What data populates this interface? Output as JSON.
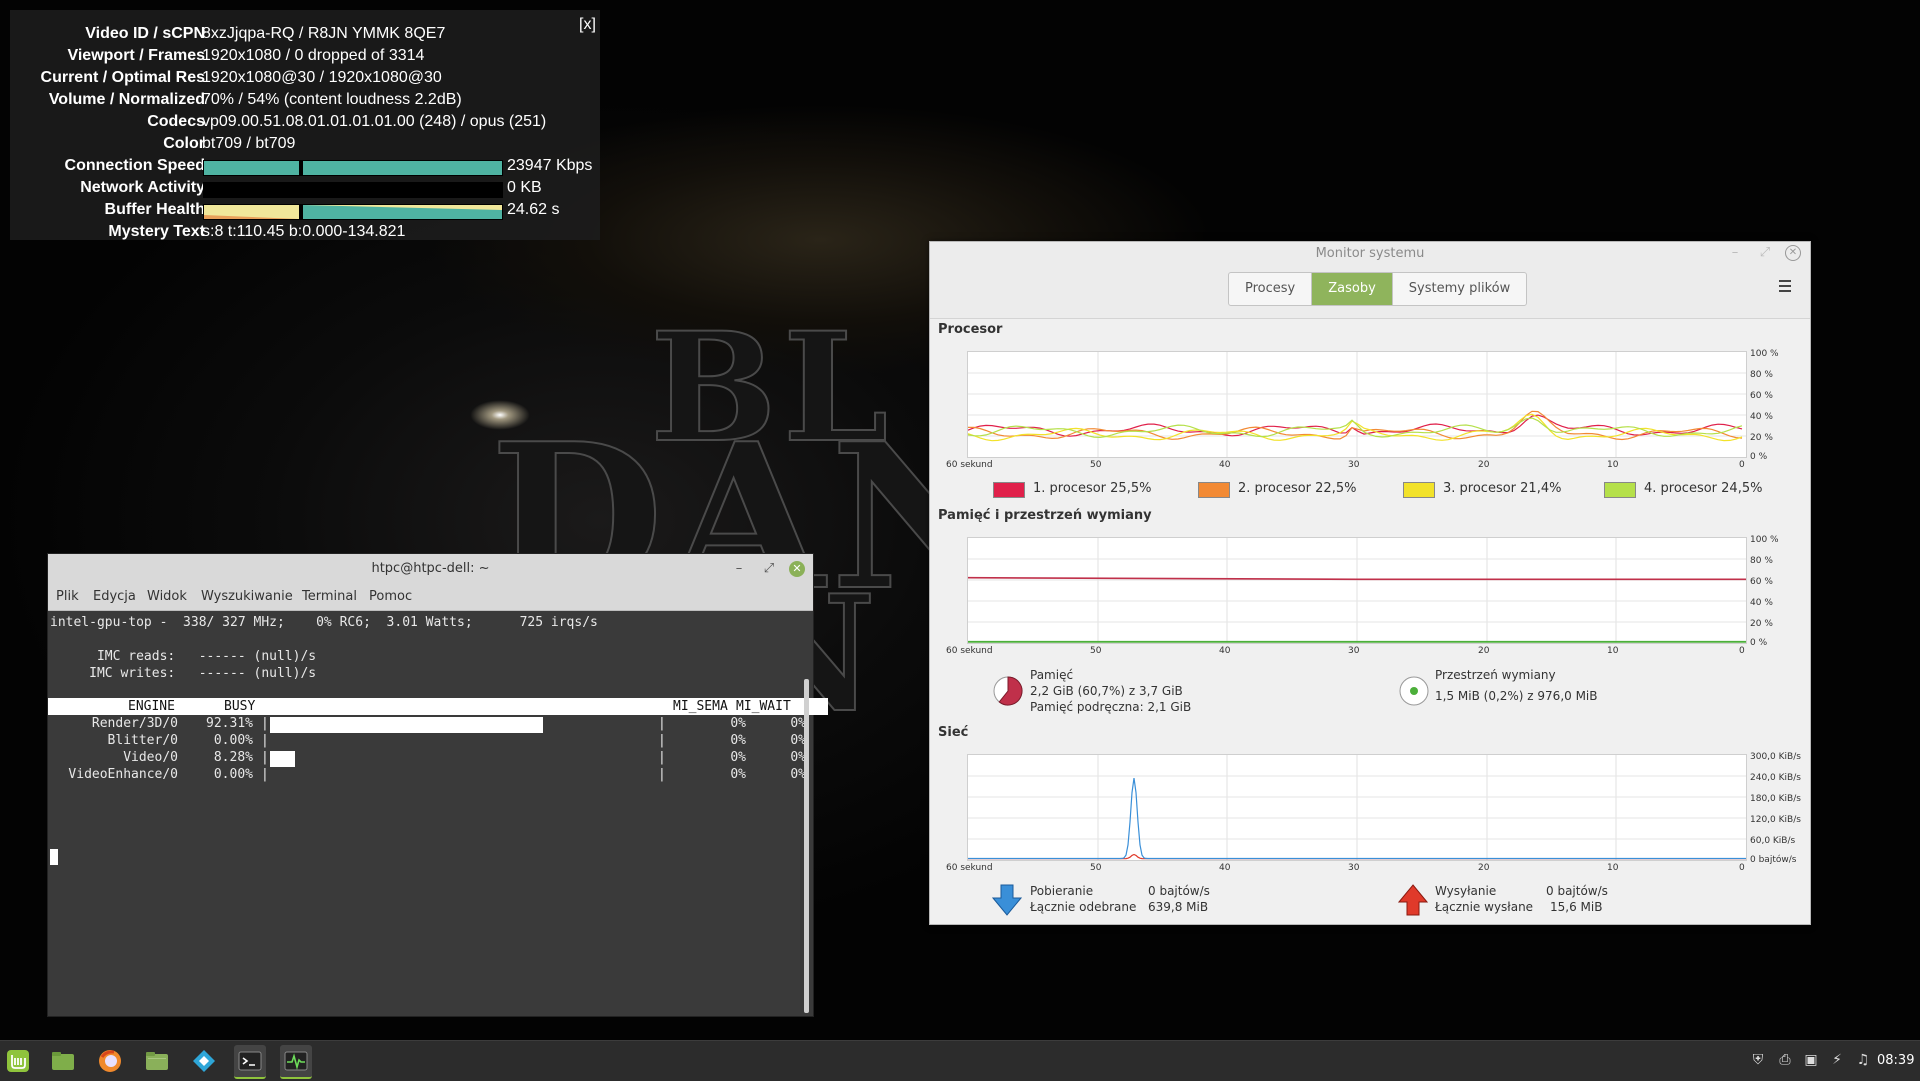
{
  "video": {
    "title_art": [
      "BL",
      "DAN",
      "N"
    ]
  },
  "stats_overlay": {
    "close_label": "[x]",
    "rows": [
      {
        "label": "Video ID / sCPN",
        "value": "8xzJjqpa-RQ / R8JN YMMK 8QE7"
      },
      {
        "label": "Viewport / Frames",
        "value": "1920x1080 / 0 dropped of 3314"
      },
      {
        "label": "Current / Optimal Res",
        "value": "1920x1080@30 / 1920x1080@30"
      },
      {
        "label": "Volume / Normalized",
        "value": "70% / 54% (content loudness 2.2dB)"
      },
      {
        "label": "Codecs",
        "value": "vp09.00.51.08.01.01.01.01.00 (248) / opus (251)"
      },
      {
        "label": "Color",
        "value": "bt709 / bt709"
      }
    ],
    "connection_speed": {
      "label": "Connection Speed",
      "value": "23947 Kbps",
      "level": 1.0
    },
    "network_activity": {
      "label": "Network Activity",
      "value": "0 KB",
      "level": 0.0
    },
    "buffer_health": {
      "label": "Buffer Health",
      "value": "24.62 s",
      "level": 1.0
    },
    "mystery_text": {
      "label": "Mystery Text",
      "value": "s:8 t:110.45 b:0.000-134.821"
    },
    "colors": {
      "bar_teal": "#4fb3a2",
      "bar_yellow": "#f0e79a",
      "bar_orange": "#e8a05a"
    }
  },
  "terminal": {
    "title": "htpc@htpc-dell: ~",
    "window_controls": {
      "minimize": "–",
      "maximize": "⤢",
      "close": "✕"
    },
    "menu": [
      "Plik",
      "Edycja",
      "Widok",
      "Wyszukiwanie",
      "Terminal",
      "Pomoc"
    ],
    "lines": [
      "intel-gpu-top -  338/ 327 MHz;    0% RC6;  3.01 Watts;      725 irqs/s",
      "",
      "      IMC reads:   ------ (null)/s",
      "     IMC writes:   ------ (null)/s"
    ],
    "table_header": {
      "engine": "ENGINE",
      "busy": "BUSY",
      "mi_sema": "MI_SEMA",
      "mi_wait": "MI_WAIT"
    },
    "engines": [
      {
        "name": "Render/3D/0",
        "busy": "92.31%",
        "busy_level": 0.9231,
        "mi_sema": "0%",
        "mi_wait": "0%"
      },
      {
        "name": "Blitter/0",
        "busy": "0.00%",
        "busy_level": 0.0,
        "mi_sema": "0%",
        "mi_wait": "0%"
      },
      {
        "name": "Video/0",
        "busy": "8.28%",
        "busy_level": 0.0828,
        "mi_sema": "0%",
        "mi_wait": "0%"
      },
      {
        "name": "VideoEnhance/0",
        "busy": "0.00%",
        "busy_level": 0.0,
        "mi_sema": "0%",
        "mi_wait": "0%"
      }
    ]
  },
  "sysmon": {
    "title": "Monitor systemu",
    "tabs": [
      {
        "label": "Procesy",
        "active": false
      },
      {
        "label": "Zasoby",
        "active": true
      },
      {
        "label": "Systemy plików",
        "active": false
      }
    ],
    "cpu": {
      "section_title": "Procesor",
      "x_labels": [
        "60 sekund",
        "50",
        "40",
        "30",
        "20",
        "10",
        "0"
      ],
      "y_labels": [
        "100 %",
        "80 %",
        "60 %",
        "40 %",
        "20 %",
        "0 %"
      ],
      "legend": [
        {
          "label": "1. procesor  25,5%",
          "color": "#e0204a"
        },
        {
          "label": "2. procesor  22,5%",
          "color": "#f28a34"
        },
        {
          "label": "3. procesor  21,4%",
          "color": "#f2e22a"
        },
        {
          "label": "4. procesor  24,5%",
          "color": "#b5e04a"
        }
      ]
    },
    "memory": {
      "section_title": "Pamięć i przestrzeń wymiany",
      "x_labels": [
        "60 sekund",
        "50",
        "40",
        "30",
        "20",
        "10",
        "0"
      ],
      "y_labels": [
        "100 %",
        "80 %",
        "60 %",
        "40 %",
        "20 %",
        "0 %"
      ],
      "mem_label": "Pamięć",
      "mem_value": "2,2 GiB (60,7%) z 3,7 GiB",
      "mem_cache": "Pamięć podręczna: 2,1 GiB",
      "mem_level": 0.607,
      "swap_label": "Przestrzeń wymiany",
      "swap_value": "1,5 MiB (0,2%) z 976,0 MiB",
      "swap_level": 0.002,
      "colors": {
        "memory": "#c0304a",
        "swap": "#4caf3a"
      }
    },
    "network": {
      "section_title": "Sieć",
      "x_labels": [
        "60 sekund",
        "50",
        "40",
        "30",
        "20",
        "10",
        "0"
      ],
      "y_labels": [
        "300,0 KiB/s",
        "240,0 KiB/s",
        "180,0 KiB/s",
        "120,0 KiB/s",
        "60,0 KiB/s",
        "0 bajtów/s"
      ],
      "download_label": "Pobieranie",
      "download_rate": "0 bajtów/s",
      "received_label": "Łącznie odebrane",
      "received_total": "639,8 MiB",
      "upload_label": "Wysyłanie",
      "upload_rate": "0 bajtów/s",
      "sent_label": "Łącznie wysłane",
      "sent_total": "15,6 MiB",
      "colors": {
        "download": "#3a8fd8",
        "upload": "#e03a2a"
      }
    }
  },
  "taskbar": {
    "apps": [
      {
        "name": "menu-icon-mint",
        "color": "#8fc43c"
      },
      {
        "name": "files-icon",
        "color": "#7fae4a"
      },
      {
        "name": "firefox-icon",
        "color": "#f0892c"
      },
      {
        "name": "folder-icon",
        "color": "#8ab05a"
      },
      {
        "name": "kodi-icon",
        "color": "#2ea6d8"
      },
      {
        "name": "terminal-icon",
        "color": "#333333"
      },
      {
        "name": "system-monitor-icon",
        "color": "#333333"
      }
    ],
    "clock": "08:39"
  }
}
